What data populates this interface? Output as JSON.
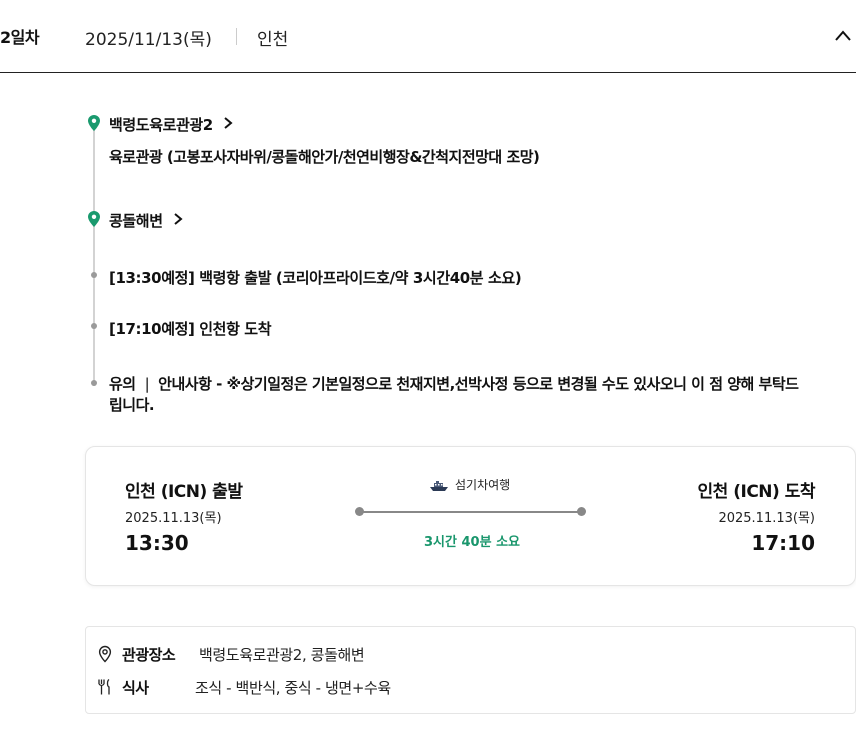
{
  "day": {
    "label": "2일차",
    "date": "2025/11/13(목)",
    "city": "인천"
  },
  "timeline": {
    "place1": {
      "title": "백령도육로관광2",
      "desc": "육로관광 (고봉포사자바위/콩돌해안가/천연비행장&간척지전망대 조망)"
    },
    "place2": {
      "title": "콩돌해변"
    },
    "item1": "[13:30예정] 백령항 출발 (코리아프라이드호/약 3시간40분 소요)",
    "item2": "[17:10예정] 인천항 도착",
    "notice": {
      "label": "유의",
      "separator": "|",
      "text": "안내사항 - ※상기일정은 기본일정으로 천재지변,선박사정 등으로 변경될 수도 있사오니 이 점 양해 부탁드립니다."
    }
  },
  "transport": {
    "type": "섬기차여행",
    "departure": {
      "city": "인천 (ICN) 출발",
      "date": "2025.11.13(목)",
      "time": "13:30"
    },
    "arrival": {
      "city": "인천 (ICN) 도착",
      "date": "2025.11.13(목)",
      "time": "17:10"
    },
    "duration": "3시간 40분 소요"
  },
  "summary": {
    "attractions": {
      "label": "관광장소",
      "value": "백령도육로관광2, 콩돌해변"
    },
    "meals": {
      "label": "식사",
      "value": "조식 - 백반식, 중식 - 냉면+수육"
    }
  },
  "colors": {
    "accent": "#19966c",
    "pin": "#1a9a6e"
  },
  "icons": {
    "pin": "map-pin-icon",
    "chevron": "chevron-right-icon",
    "collapse": "chevron-up-icon",
    "ship": "ship-icon",
    "location": "location-icon",
    "meal": "fork-knife-icon"
  }
}
